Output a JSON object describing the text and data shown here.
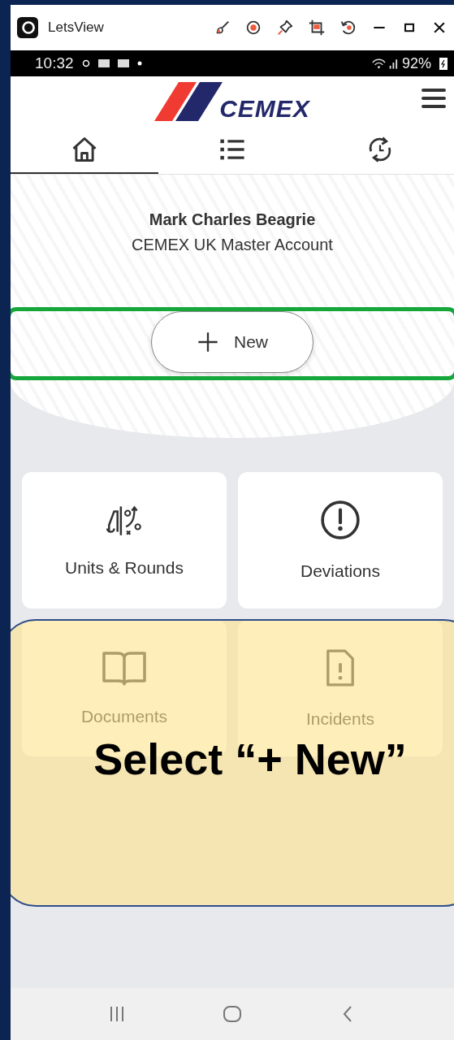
{
  "window": {
    "title": "LetsView"
  },
  "status_bar": {
    "time": "10:32",
    "battery": "92%"
  },
  "header": {
    "logo_text": "CEMEX"
  },
  "tabs": [
    {
      "kind": "home",
      "selected": true
    },
    {
      "kind": "list",
      "selected": false
    },
    {
      "kind": "sync",
      "selected": false
    }
  ],
  "user": {
    "name": "Mark Charles Beagrie",
    "account": "CEMEX UK Master Account"
  },
  "new_button": {
    "label": "New"
  },
  "tiles": [
    {
      "kind": "units",
      "label": "Units & Rounds"
    },
    {
      "kind": "deviations",
      "label": "Deviations"
    },
    {
      "kind": "documents",
      "label": "Documents"
    },
    {
      "kind": "incidents",
      "label": "Incidents"
    }
  ],
  "callout": {
    "text": "Select “+ New”"
  }
}
